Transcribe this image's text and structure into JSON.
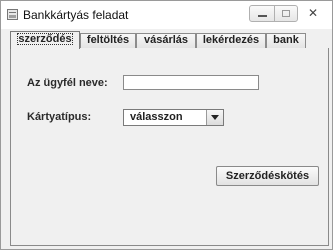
{
  "window": {
    "title": "Bankkártyás feladat",
    "close_glyph": "✕"
  },
  "tabs": [
    {
      "label": "szerződés",
      "active": true
    },
    {
      "label": "feltöltés",
      "active": false
    },
    {
      "label": "vásárlás",
      "active": false
    },
    {
      "label": "lekérdezés",
      "active": false
    },
    {
      "label": "bank",
      "active": false
    }
  ],
  "form": {
    "name_label": "Az ügyfél neve:",
    "name_value": "",
    "card_type_label": "Kártyatípus:",
    "card_type_selected": "válasszon",
    "submit_label": "Szerződéskötés"
  },
  "icons": {
    "app": "java-app-icon",
    "minimize": "minimize-icon",
    "maximize": "maximize-icon",
    "close": "close-icon",
    "dropdown": "chevron-down-icon"
  }
}
